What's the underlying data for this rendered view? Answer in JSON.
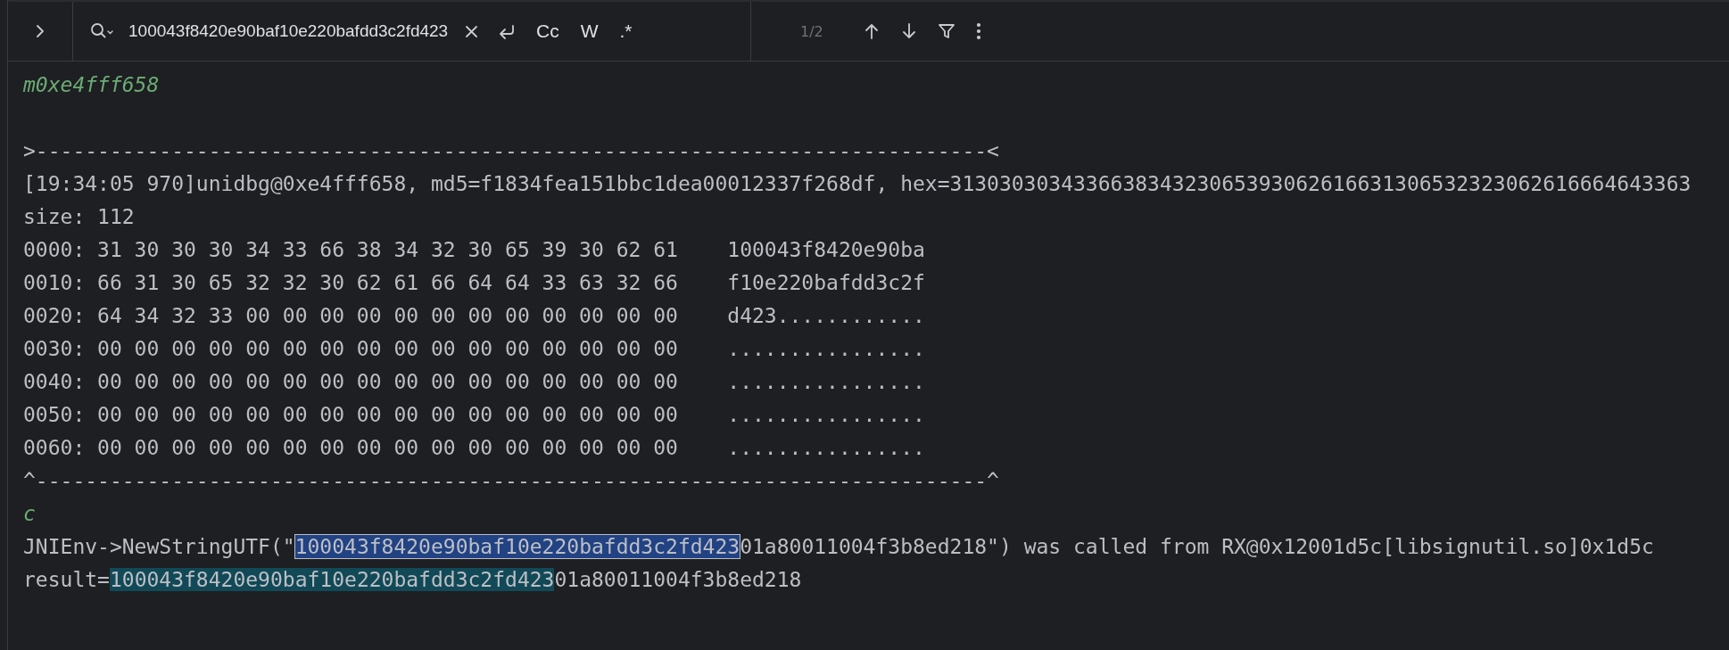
{
  "toolbar": {
    "query": "100043f8420e90baf10e220bafdd3c2fd423",
    "options": [
      {
        "label": "Cc",
        "on": false
      },
      {
        "label": "W",
        "on": false
      },
      {
        "label": ".*",
        "on": false
      }
    ],
    "match_count": "1/2"
  },
  "console": {
    "lines": [
      {
        "kind": "italic",
        "text": "m0xe4fff658"
      },
      {
        "kind": "blank"
      },
      {
        "kind": "plain",
        "text": ">-----------------------------------------------------------------------------<"
      },
      {
        "kind": "plain",
        "text": "[19:34:05 970]unidbg@0xe4fff658, md5=f1834fea151bbc1dea00012337f268df, hex=313030303433663834323065393062616631306532323062616664643363"
      },
      {
        "kind": "plain",
        "text": "size: 112"
      },
      {
        "kind": "plain",
        "text": "0000: 31 30 30 30 34 33 66 38 34 32 30 65 39 30 62 61    100043f8420e90ba"
      },
      {
        "kind": "plain",
        "text": "0010: 66 31 30 65 32 32 30 62 61 66 64 64 33 63 32 66    f10e220bafdd3c2f"
      },
      {
        "kind": "plain",
        "text": "0020: 64 34 32 33 00 00 00 00 00 00 00 00 00 00 00 00    d423............"
      },
      {
        "kind": "plain",
        "text": "0030: 00 00 00 00 00 00 00 00 00 00 00 00 00 00 00 00    ................"
      },
      {
        "kind": "plain",
        "text": "0040: 00 00 00 00 00 00 00 00 00 00 00 00 00 00 00 00    ................"
      },
      {
        "kind": "plain",
        "text": "0050: 00 00 00 00 00 00 00 00 00 00 00 00 00 00 00 00    ................"
      },
      {
        "kind": "plain",
        "text": "0060: 00 00 00 00 00 00 00 00 00 00 00 00 00 00 00 00    ................"
      },
      {
        "kind": "plain",
        "text": "^-----------------------------------------------------------------------------^"
      },
      {
        "kind": "italic",
        "text": "c"
      },
      {
        "kind": "segmented",
        "segments": [
          {
            "text": "JNIEnv->NewStringUTF(\"",
            "match": false,
            "current": false
          },
          {
            "text": "100043f8420e90baf10e220bafdd3c2fd423",
            "match": true,
            "current": true
          },
          {
            "text": "01a80011004f3b8ed218\") was called from RX@0x12001d5c[libsignutil.so]0x1d5c",
            "match": false,
            "current": false
          }
        ]
      },
      {
        "kind": "segmented",
        "segments": [
          {
            "text": "result=",
            "match": false,
            "current": false
          },
          {
            "text": "100043f8420e90baf10e220bafdd3c2fd423",
            "match": true,
            "current": false
          },
          {
            "text": "01a80011004f3b8ed218",
            "match": false,
            "current": false
          }
        ]
      }
    ]
  }
}
